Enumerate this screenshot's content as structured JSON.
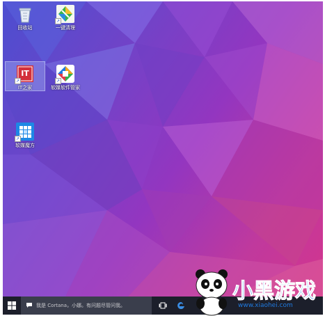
{
  "desktop": {
    "icons": [
      {
        "label": "回收站",
        "icon": "recycle-bin-icon"
      },
      {
        "label": "一键清理",
        "icon": "broom-clean-icon"
      },
      {
        "label": "IT之家",
        "icon": "ithome-logo-icon",
        "logo_text": "IT"
      },
      {
        "label": "软媒软件管家",
        "icon": "software-manager-icon"
      },
      {
        "label": "软媒魔方",
        "icon": "rubik-cube-icon"
      }
    ]
  },
  "taskbar": {
    "search_placeholder": "我是 Cortana，小娜。有问题尽管问我。",
    "start_icon": "windows-logo-icon",
    "task_view_icon": "task-view-icon",
    "browser_icon": "edge-browser-icon"
  },
  "watermark": {
    "text_main": "小黑游戏",
    "text_url": "www.xiaohei.com"
  },
  "colors": {
    "taskbar": "#1c1f2b",
    "search_box": "#3a3e4c",
    "accent_blue": "#1f7ae0",
    "ithome_red": "#d32f3a"
  }
}
